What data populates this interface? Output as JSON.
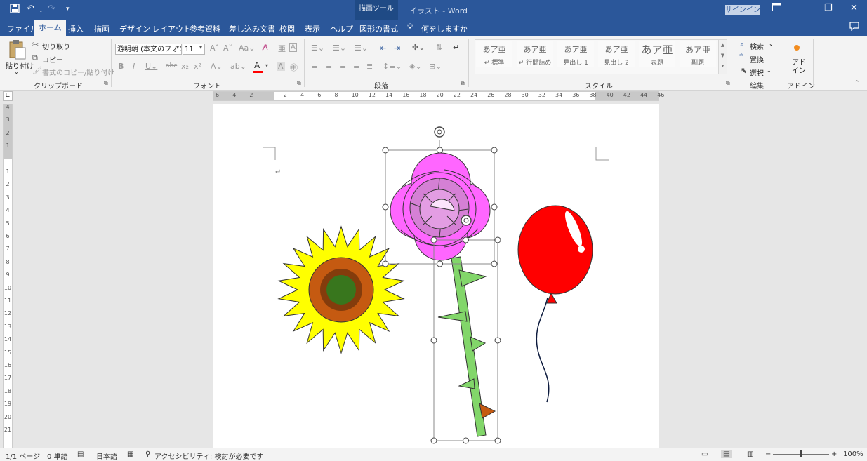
{
  "titlebar": {
    "context_tab": "描画ツール",
    "doc_title": "イラスト  -  Word",
    "signin": "サインイン",
    "icons": [
      "save-icon",
      "undo-icon",
      "redo-icon",
      "customize-icon",
      "ribbon-display-icon",
      "minimize-icon",
      "restore-icon",
      "close-icon"
    ]
  },
  "tabs": [
    "ファイル",
    "ホーム",
    "挿入",
    "描画",
    "デザイン",
    "レイアウト",
    "参考資料",
    "差し込み文書",
    "校閲",
    "表示",
    "ヘルプ",
    "図形の書式"
  ],
  "tellme": "何をしますか",
  "ribbon": {
    "clipboard": {
      "paste": "貼り付け",
      "cut": "切り取り",
      "copy": "コピー",
      "format_painter": "書式のコピー/貼り付け",
      "label": "クリップボード"
    },
    "font": {
      "name": "游明朝 (本文のフォン",
      "size": "11",
      "label": "フォント",
      "color": "#ff0000"
    },
    "paragraph": {
      "label": "段落"
    },
    "styles": {
      "label": "スタイル",
      "items": [
        {
          "preview": "あア亜",
          "name": "↵ 標準"
        },
        {
          "preview": "あア亜",
          "name": "↵ 行間詰め"
        },
        {
          "preview": "あア亜",
          "name": "見出し 1"
        },
        {
          "preview": "あア亜",
          "name": "見出し 2"
        },
        {
          "preview": "あア亜",
          "name": "表題"
        },
        {
          "preview": "あア亜",
          "name": "副題"
        }
      ]
    },
    "editing": {
      "find": "検索",
      "replace": "置換",
      "select": "選択",
      "label": "編集"
    },
    "addins": {
      "button": "アド\nイン",
      "label": "アドイン"
    }
  },
  "ruler": {
    "h_labels": [
      "6",
      "4",
      "2",
      "",
      "2",
      "4",
      "6",
      "8",
      "10",
      "12",
      "14",
      "16",
      "18",
      "20",
      "22",
      "24",
      "26",
      "28",
      "30",
      "32",
      "34",
      "36",
      "38",
      "40",
      "42",
      "44",
      "46"
    ],
    "v_labels": [
      "4",
      "3",
      "2",
      "1",
      "",
      "1",
      "2",
      "3",
      "4",
      "5",
      "6",
      "7",
      "8",
      "9",
      "10",
      "11",
      "12",
      "13",
      "14",
      "15",
      "16",
      "17",
      "18",
      "19",
      "20",
      "21"
    ]
  },
  "drawing": {
    "colors": {
      "sunflower_petals": "#ffff00",
      "sunflower_ring": "#c55a11",
      "sunflower_inner_ring": "#843c0c",
      "sunflower_center": "#38761d",
      "rose_outer": "#ff66ff",
      "rose_middle": "#d580d5",
      "rose_inner": "#e39de3",
      "stem": "#82d66a",
      "thorn_accent": "#c55a11",
      "balloon": "#ff0000",
      "balloon_highlight": "#ffffff",
      "string": "#0d1b3e"
    },
    "paragraph_mark": "↵"
  },
  "statusbar": {
    "page": "1/1 ページ",
    "words": "0 単語",
    "language": "日本語",
    "accessibility": "アクセシビリティ: 検討が必要です",
    "zoom": "100%"
  }
}
